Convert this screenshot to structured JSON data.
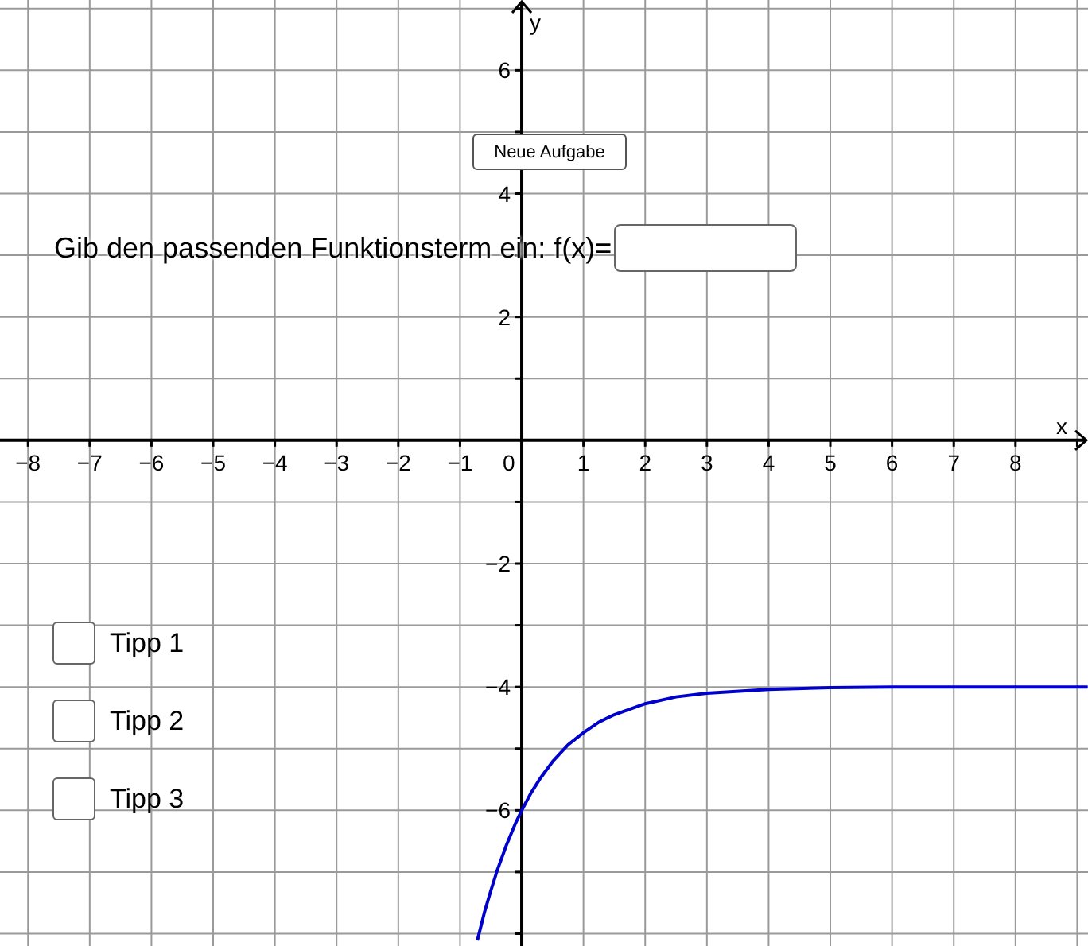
{
  "graph": {
    "origin_label": "0",
    "chart_data": {
      "type": "line",
      "grid": true,
      "xlabel": "x",
      "ylabel": "y",
      "xlim": [
        -8.454,
        9.175
      ],
      "ylim": [
        -8.2,
        7.139
      ],
      "xticks": [
        {
          "value": -8,
          "label": "−8"
        },
        {
          "value": -7,
          "label": "−7"
        },
        {
          "value": -6,
          "label": "−6"
        },
        {
          "value": -5,
          "label": "−5"
        },
        {
          "value": -4,
          "label": "−4"
        },
        {
          "value": -3,
          "label": "−3"
        },
        {
          "value": -2,
          "label": "−2"
        },
        {
          "value": -1,
          "label": "−1"
        },
        {
          "value": 1,
          "label": "1"
        },
        {
          "value": 2,
          "label": "2"
        },
        {
          "value": 3,
          "label": "3"
        },
        {
          "value": 4,
          "label": "4"
        },
        {
          "value": 5,
          "label": "5"
        },
        {
          "value": 6,
          "label": "6"
        },
        {
          "value": 7,
          "label": "7"
        },
        {
          "value": 8,
          "label": "8"
        }
      ],
      "yticks": [
        {
          "value": -6,
          "label": "−6"
        },
        {
          "value": -4,
          "label": "−4"
        },
        {
          "value": -2,
          "label": "−2"
        },
        {
          "value": 2,
          "label": "2"
        },
        {
          "value": 4,
          "label": "4"
        },
        {
          "value": 6,
          "label": "6"
        }
      ],
      "x": [
        -0.72,
        -0.6,
        -0.5,
        -0.4,
        -0.25,
        -0.1,
        0,
        0.15,
        0.3,
        0.5,
        0.75,
        1,
        1.25,
        1.5,
        2,
        2.5,
        3,
        4,
        5,
        6,
        7,
        8,
        9.17
      ],
      "series": [
        {
          "color": "#0000cc",
          "values": [
            -8.11,
            -7.64,
            -7.3,
            -6.98,
            -6.57,
            -6.21,
            -6,
            -5.72,
            -5.48,
            -5.21,
            -4.94,
            -4.74,
            -4.57,
            -4.45,
            -4.27,
            -4.16,
            -4.1,
            -4.04,
            -4.01,
            -4.0,
            -4.0,
            -4.0,
            -4.0
          ]
        }
      ]
    }
  },
  "new_task_button": {
    "label": "Neue Aufgabe"
  },
  "prompt": {
    "text": "Gib den passenden Funktionsterm ein: f(x)="
  },
  "hints": [
    {
      "label": "Tipp 1",
      "checked": false
    },
    {
      "label": "Tipp 2",
      "checked": false
    },
    {
      "label": "Tipp 3",
      "checked": false
    }
  ]
}
